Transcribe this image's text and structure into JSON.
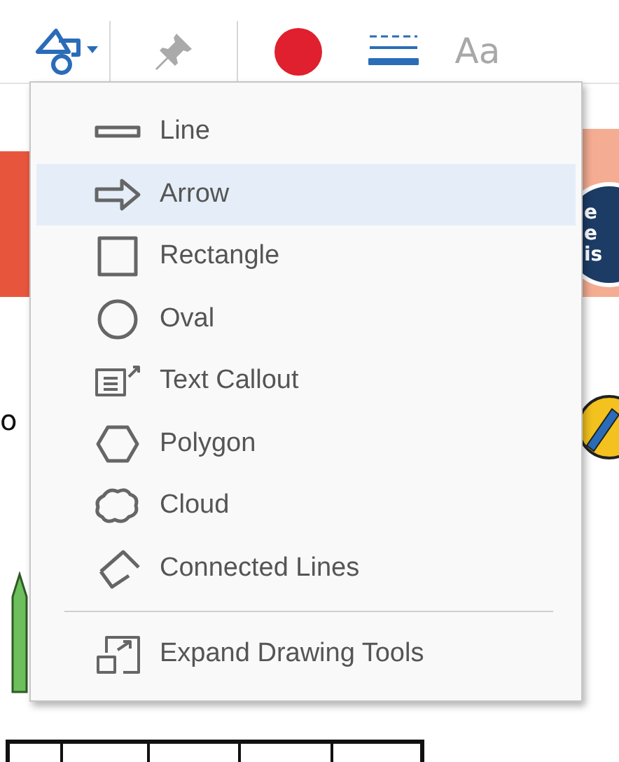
{
  "toolbar": {
    "tools": [
      {
        "kind": "shapes"
      },
      {
        "kind": "pin"
      },
      {
        "kind": "color",
        "color": "#e0202e"
      },
      {
        "kind": "lines"
      },
      {
        "kind": "font",
        "label": "Aa"
      }
    ]
  },
  "document": {
    "text_fragment": "o",
    "badge_lines": [
      "e",
      "e",
      "is"
    ]
  },
  "shape_menu": {
    "items": [
      {
        "kind": "line",
        "label": "Line",
        "selected": false
      },
      {
        "kind": "arrow",
        "label": "Arrow",
        "selected": true
      },
      {
        "kind": "rectangle",
        "label": "Rectangle",
        "selected": false
      },
      {
        "kind": "oval",
        "label": "Oval",
        "selected": false
      },
      {
        "kind": "callout",
        "label": "Text Callout",
        "selected": false
      },
      {
        "kind": "polygon",
        "label": "Polygon",
        "selected": false
      },
      {
        "kind": "cloud",
        "label": "Cloud",
        "selected": false
      },
      {
        "kind": "polyline",
        "label": "Connected Lines",
        "selected": false
      }
    ],
    "footer": {
      "kind": "expand",
      "label": "Expand Drawing Tools"
    }
  }
}
